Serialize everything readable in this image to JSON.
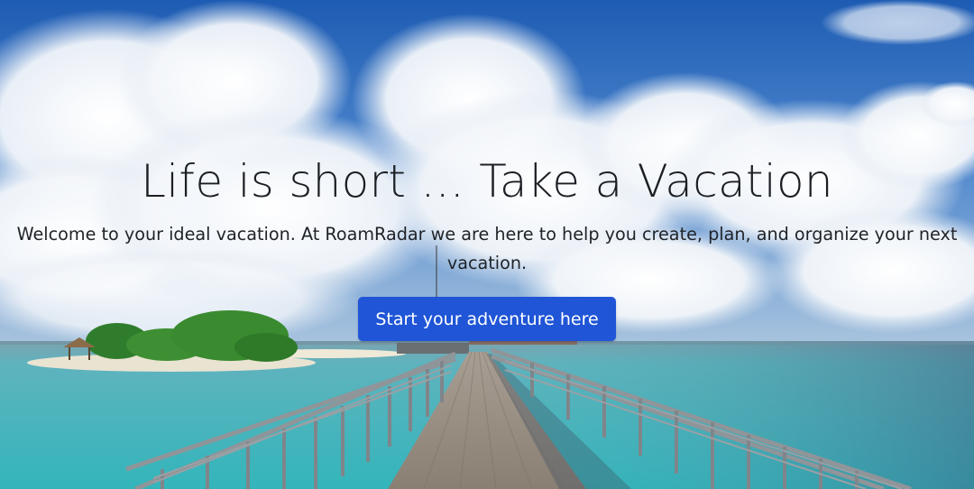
{
  "hero": {
    "headline": "Life is short ... Take a Vacation",
    "subtitle": "Welcome to your ideal vacation. At RoamRadar we are here to help you create, plan, and organize your next vacation.",
    "cta_label": "Start your adventure here"
  },
  "colors": {
    "sky_top": "#1f5eb4",
    "sky_mid": "#5d92d3",
    "sea_near": "#3fb9be",
    "sea_far": "#7d9aa7",
    "accent_button": "#1f55d6",
    "headline_text": "#1b1f24"
  },
  "background_scene": "tropical ocean with wooden boardwalk, island and cumulus clouds"
}
